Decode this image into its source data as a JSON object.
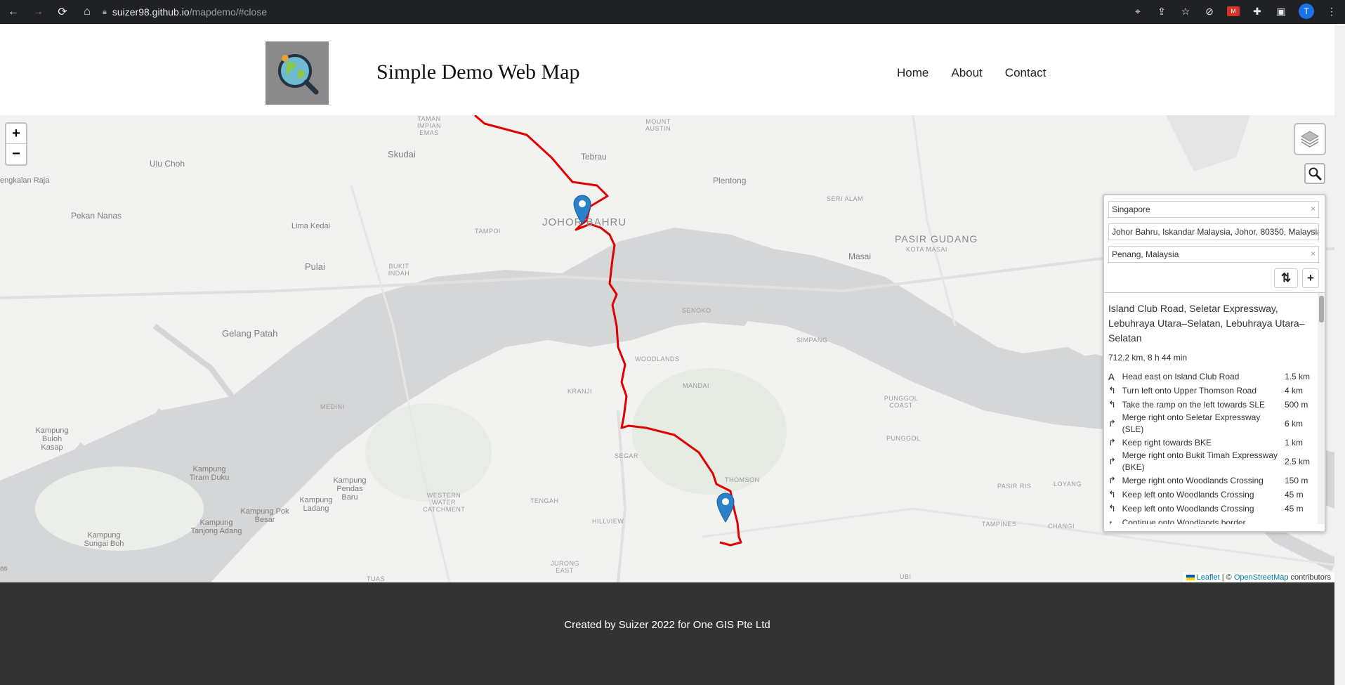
{
  "browser": {
    "url_host": "suizer98.github.io",
    "url_path": "/mapdemo/#close",
    "profile_initial": "T",
    "icons": [
      "back-icon",
      "forward-icon",
      "reload-icon",
      "home-icon",
      "lock-icon",
      "location-icon",
      "share-icon",
      "star-icon",
      "extension-icon",
      "extension-red-icon",
      "puzzle-icon",
      "sidebar-icon",
      "menu-icon"
    ]
  },
  "header": {
    "title": "Simple Demo Web Map",
    "nav": [
      {
        "label": "Home"
      },
      {
        "label": "About"
      },
      {
        "label": "Contact"
      }
    ]
  },
  "map": {
    "zoom_in": "+",
    "zoom_out": "−",
    "places": [
      {
        "name": "Skudai"
      },
      {
        "name": "Tebrau"
      },
      {
        "name": "Plentong"
      },
      {
        "name": "Ulu Choh"
      },
      {
        "name": "engkalan Raja"
      },
      {
        "name": "Pekan Nanas"
      },
      {
        "name": "Lima Kedai"
      },
      {
        "name": "JOHOR BAHRU"
      },
      {
        "name": "PASIR GUDANG"
      },
      {
        "name": "Masai"
      },
      {
        "name": "Pulai"
      },
      {
        "name": "Gelang Patah"
      },
      {
        "name": "Kampung Buloh Kasap"
      },
      {
        "name": "Kampung Tiram Duku"
      },
      {
        "name": "Kampung Pendas Baru"
      },
      {
        "name": "Kampung Ladang"
      },
      {
        "name": "Kampung Pok Besar"
      },
      {
        "name": "Kampung Tanjong Adang"
      },
      {
        "name": "Kampung Sungai Boh"
      },
      {
        "name": "TAMAN IMPIAN EMAS"
      },
      {
        "name": "MOUNT AUSTIN"
      },
      {
        "name": "SERI ALAM"
      },
      {
        "name": "KOTA MASAI"
      },
      {
        "name": "TAMPOI"
      },
      {
        "name": "BUKIT INDAH"
      },
      {
        "name": "SENOKO"
      },
      {
        "name": "WOODLANDS"
      },
      {
        "name": "SIMPANG"
      },
      {
        "name": "KRANJI"
      },
      {
        "name": "MANDAI"
      },
      {
        "name": "MEDINI"
      },
      {
        "name": "PUNGGOL COAST"
      },
      {
        "name": "PUNGGOL"
      },
      {
        "name": "SEGAR"
      },
      {
        "name": "THOMSON"
      },
      {
        "name": "TENGAH"
      },
      {
        "name": "WESTERN WATER CATCHMENT"
      },
      {
        "name": "HILLVIEW"
      },
      {
        "name": "JURONG EAST"
      },
      {
        "name": "PASIR RIS"
      },
      {
        "name": "LOYANG"
      },
      {
        "name": "TAMPINES"
      },
      {
        "name": "CHANGI"
      },
      {
        "name": "TUAS"
      },
      {
        "name": "UBI"
      },
      {
        "name": "as"
      }
    ],
    "attribution": {
      "leaflet": "Leaflet",
      "sep": " | © ",
      "osm": "OpenStreetMap",
      "suffix": " contributors"
    }
  },
  "routing": {
    "waypoints": [
      {
        "value": "Singapore"
      },
      {
        "value": "Johor Bahru, Iskandar Malaysia, Johor, 80350, Malaysia"
      },
      {
        "value": "Penang, Malaysia"
      }
    ],
    "reverse_label": "⇅",
    "add_label": "+",
    "route_name": "Island Club Road, Seletar Expressway, Lebuhraya Utara–Selatan, Lebuhraya Utara–Selatan",
    "summary": "712.2 km, 8 h 44 min",
    "instructions": [
      {
        "icon": "depart-icon",
        "glyph": "A",
        "text": "Head east on Island Club Road",
        "distance": "1.5 km"
      },
      {
        "icon": "turn-left-icon",
        "glyph": "↰",
        "text": "Turn left onto Upper Thomson Road",
        "distance": "4 km"
      },
      {
        "icon": "slight-left-icon",
        "glyph": "↰",
        "text": "Take the ramp on the left towards SLE",
        "distance": "500 m"
      },
      {
        "icon": "merge-right-icon",
        "glyph": "↱",
        "text": "Merge right onto Seletar Expressway (SLE)",
        "distance": "6 km"
      },
      {
        "icon": "keep-right-icon",
        "glyph": "↱",
        "text": "Keep right towards BKE",
        "distance": "1 km"
      },
      {
        "icon": "merge-right-icon",
        "glyph": "↱",
        "text": "Merge right onto Bukit Timah Expressway (BKE)",
        "distance": "2.5 km"
      },
      {
        "icon": "merge-right-icon",
        "glyph": "↱",
        "text": "Merge right onto Woodlands Crossing",
        "distance": "150 m"
      },
      {
        "icon": "keep-left-icon",
        "glyph": "↰",
        "text": "Keep left onto Woodlands Crossing",
        "distance": "45 m"
      },
      {
        "icon": "keep-left-icon",
        "glyph": "↰",
        "text": "Keep left onto Woodlands Crossing",
        "distance": "45 m"
      },
      {
        "icon": "continue-icon",
        "glyph": "↑",
        "text": "Continue onto Woodlands border",
        "distance": ""
      }
    ]
  },
  "footer": {
    "text": "Created by Suizer 2022 for One GIS Pte Ltd"
  },
  "colors": {
    "route": "#e00000",
    "marker": "#2a81cb",
    "water": "#d4d6d7",
    "land": "#f2f2f0",
    "footer": "#333333"
  }
}
